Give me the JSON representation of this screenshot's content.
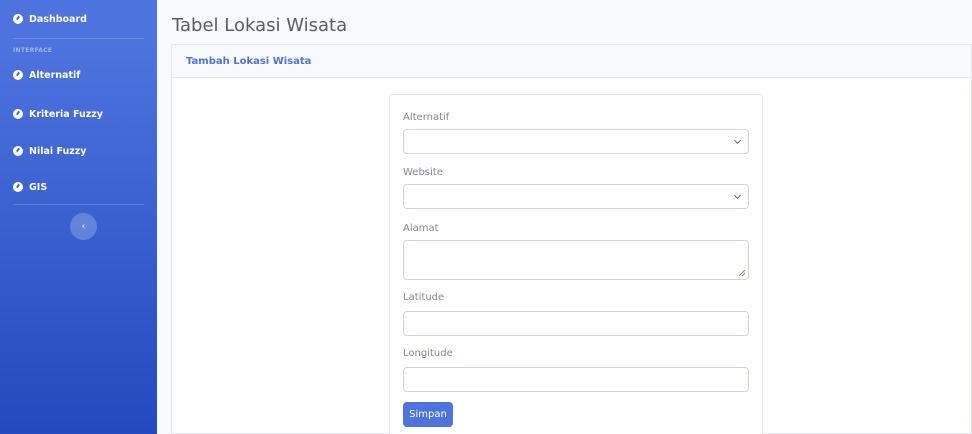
{
  "sidebar": {
    "items": [
      {
        "label": "Dashboard",
        "icon": "tachometer-icon"
      },
      {
        "label": "Alternatif",
        "icon": "tachometer-icon"
      },
      {
        "label": "Kriteria Fuzzy",
        "icon": "tachometer-icon"
      },
      {
        "label": "Nilai Fuzzy",
        "icon": "tachometer-icon"
      },
      {
        "label": "GIS",
        "icon": "tachometer-icon"
      }
    ],
    "heading": "INTERFACE",
    "toggle_icon": "‹"
  },
  "page": {
    "title": "Tabel Lokasi Wisata"
  },
  "card": {
    "header": "Tambah Lokasi Wisata"
  },
  "form": {
    "alternatif_label": "Alternatif",
    "alternatif_value": "",
    "website_label": "Website",
    "website_value": "",
    "alamat_label": "Alamat",
    "alamat_value": "",
    "latitude_label": "Latitude",
    "latitude_value": "",
    "longitude_label": "Longitude",
    "longitude_value": "",
    "submit_label": "Simpan"
  },
  "colors": {
    "primary": "#4e73df",
    "sidebar_dark": "#224abe",
    "title_text": "#5a5c69",
    "body_text": "#858796"
  }
}
